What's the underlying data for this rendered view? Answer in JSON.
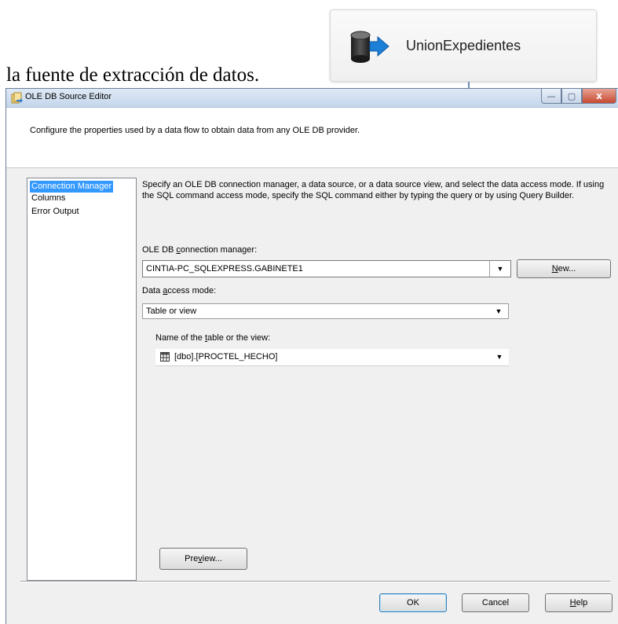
{
  "document": {
    "text": "la fuente de extracción de datos."
  },
  "component": {
    "label": "UnionExpedientes",
    "icon": "database-source-icon"
  },
  "dialog": {
    "title": "OLE DB Source Editor",
    "header_text": "Configure the properties used by a data flow to obtain data from any OLE DB provider.",
    "window_buttons": {
      "minimize": "—",
      "maximize": "▢",
      "close": "x"
    },
    "nav": {
      "items": [
        {
          "label": "Connection Manager",
          "selected": true
        },
        {
          "label": "Columns",
          "selected": false
        },
        {
          "label": "Error Output",
          "selected": false
        }
      ]
    },
    "description": "Specify an OLE DB connection manager, a data source, or a data source view, and select the data access mode. If using the SQL command access mode, specify the SQL command either by typing the query or by using Query Builder.",
    "connection_manager": {
      "label_pre": "OLE DB ",
      "label_access": "c",
      "label_post": "onnection manager:",
      "value": "CINTIA-PC_SQLEXPRESS.GABINETE1",
      "new_button_access": "N",
      "new_button_rest": "ew..."
    },
    "access_mode": {
      "label_pre": "Data ",
      "label_access": "a",
      "label_post": "ccess mode:",
      "value": "Table or view"
    },
    "table_name": {
      "label_pre": "Name of the ",
      "label_access": "t",
      "label_post": "able or the view:",
      "value": "[dbo].[PROCTEL_HECHO]",
      "icon": "table-grid-icon"
    },
    "preview_button": {
      "pre": "Pre",
      "access": "v",
      "post": "iew..."
    },
    "footer": {
      "ok": "OK",
      "cancel": "Cancel",
      "help_access": "H",
      "help_rest": "elp"
    },
    "colors": {
      "selection": "#3399ff",
      "dialog_bg": "#f0f0f0",
      "close_button": "#c74a32"
    }
  }
}
